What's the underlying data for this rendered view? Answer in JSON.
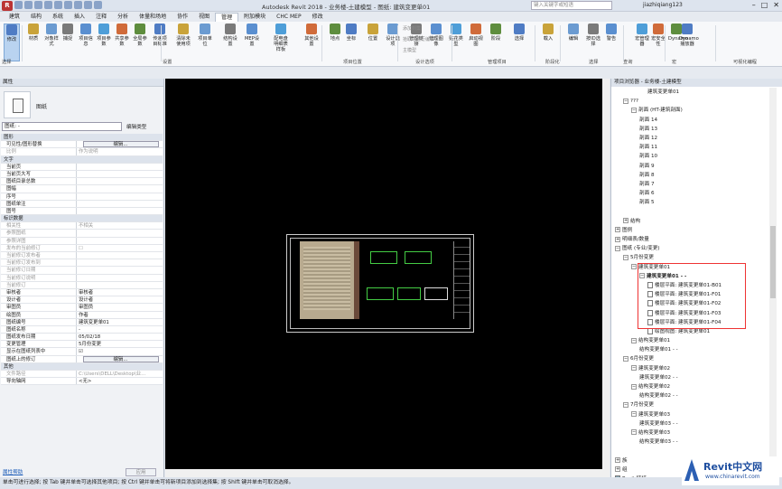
{
  "app": {
    "title": "Autodesk Revit 2018 - 业务楼-土建模型 - 图纸: 建筑变更单01",
    "search_placeholder": "键入关键字或短语",
    "user": "jiazhiqiang123",
    "r_logo": "R"
  },
  "tabs": [
    "建筑",
    "结构",
    "系统",
    "插入",
    "注释",
    "分析",
    "体量和场地",
    "协作",
    "视图",
    "管理",
    "附加模块",
    "CHC MEP",
    "修改"
  ],
  "active_tab": "管理",
  "ribbon": {
    "buttons": [
      "修改",
      "材质",
      "对象样式",
      "捕捉",
      "项目信息",
      "项目参数",
      "共享参数",
      "全局参数",
      "传递项目标准",
      "清除未使用项",
      "项目单位",
      "结构设置",
      "MEP设置",
      "配电盘明细表样板",
      "其他设置",
      "地点",
      "坐标",
      "位置",
      "设计选项",
      "管理链接",
      "管理图像",
      "贴花类型",
      "启动视图",
      "阶段",
      "选择",
      "载入",
      "编辑",
      "按ID选择",
      "警告",
      "宏管理器",
      "宏安全性",
      "Dynamo",
      "Dynamo播放器"
    ],
    "small": [
      "添加到集",
      "拾取以进行编辑",
      "主模型"
    ],
    "panels": [
      "选择",
      "设置",
      "项目位置",
      "设计选项",
      "管理项目",
      "阶段化",
      "选择",
      "查询",
      "宏",
      "可视化编程"
    ]
  },
  "properties": {
    "header": "属性",
    "type_name": "图纸",
    "filter": "图纸: -",
    "edit_type": "编辑类型",
    "rows": [
      {
        "g": "图形"
      },
      {
        "k": "可见性/图形替换",
        "b": "编辑..."
      },
      {
        "k": "比例",
        "v": "作为说明",
        "dim": true
      },
      {
        "g": "文字"
      },
      {
        "k": "当前页",
        "v": ""
      },
      {
        "k": "当前页大写",
        "v": ""
      },
      {
        "k": "图纸目录总数",
        "v": ""
      },
      {
        "k": "图幅",
        "v": ""
      },
      {
        "k": "序号",
        "v": ""
      },
      {
        "k": "图纸单注",
        "v": ""
      },
      {
        "k": "图号",
        "v": ""
      },
      {
        "g": "标识数据"
      },
      {
        "k": "相关性",
        "v": "不相关",
        "dim": true
      },
      {
        "k": "参照图纸",
        "v": "",
        "dim": true
      },
      {
        "k": "参照详图",
        "v": "",
        "dim": true
      },
      {
        "k": "发布的当前修订",
        "v": "☐",
        "dim": true
      },
      {
        "k": "当前修订发布者",
        "v": "",
        "dim": true
      },
      {
        "k": "当前修订发布到",
        "v": "",
        "dim": true
      },
      {
        "k": "当前修订日期",
        "v": "",
        "dim": true
      },
      {
        "k": "当前修订说明",
        "v": "",
        "dim": true
      },
      {
        "k": "当前修订",
        "v": "",
        "dim": true
      },
      {
        "k": "审核者",
        "v": "审核者"
      },
      {
        "k": "设计者",
        "v": "设计者"
      },
      {
        "k": "审图员",
        "v": "审图员"
      },
      {
        "k": "绘图员",
        "v": "作者"
      },
      {
        "k": "图纸编号",
        "v": "建筑变更单01"
      },
      {
        "k": "图纸名称",
        "v": "-"
      },
      {
        "k": "图纸发布日期",
        "v": "05/02/18"
      },
      {
        "k": "变更管理",
        "v": "5月份变更"
      },
      {
        "k": "显示在图纸列表中",
        "v": "☑"
      },
      {
        "k": "图纸上的修订",
        "b": "编辑..."
      },
      {
        "g": "其他"
      },
      {
        "k": "文件路径",
        "v": "C:\\Users\\DELL\\Desktop\\业...",
        "dim": true
      },
      {
        "k": "导向轴网",
        "v": "<无>"
      }
    ],
    "help": "属性帮助",
    "apply": "应用"
  },
  "browser": {
    "header": "项目浏览器 - 业务楼-土建模型",
    "items": [
      {
        "t": "建筑变更单01",
        "l": 4,
        "n": "none"
      },
      {
        "t": "???",
        "l": 1,
        "n": "minus"
      },
      {
        "t": "剖面 (HT-建筑剖面)",
        "l": 2,
        "n": "minus"
      },
      {
        "t": "剖面 14",
        "l": 3,
        "n": "none"
      },
      {
        "t": "剖面 13",
        "l": 3,
        "n": "none"
      },
      {
        "t": "剖面 12",
        "l": 3,
        "n": "none"
      },
      {
        "t": "剖面 11",
        "l": 3,
        "n": "none"
      },
      {
        "t": "剖面 10",
        "l": 3,
        "n": "none"
      },
      {
        "t": "剖面 9",
        "l": 3,
        "n": "none"
      },
      {
        "t": "剖面 8",
        "l": 3,
        "n": "none"
      },
      {
        "t": "剖面 7",
        "l": 3,
        "n": "none"
      },
      {
        "t": "剖面 6",
        "l": 3,
        "n": "none"
      },
      {
        "t": "剖面 5",
        "l": 3,
        "n": "none"
      },
      {
        "t": "",
        "l": 0,
        "n": "none"
      },
      {
        "t": "结构",
        "l": 1,
        "n": "plus"
      },
      {
        "t": "图例",
        "l": 0,
        "n": "plus"
      },
      {
        "t": "明细表/数量",
        "l": 0,
        "n": "plus"
      },
      {
        "t": "图纸 (专业/变更)",
        "l": 0,
        "n": "minus"
      },
      {
        "t": "5月份变更",
        "l": 1,
        "n": "minus"
      },
      {
        "t": "建筑变更单01",
        "l": 2,
        "n": "minus"
      },
      {
        "t": "建筑变更单01 - -",
        "l": 3,
        "n": "minus",
        "b": true
      },
      {
        "t": "楼层平面: 建筑变更单01-B01",
        "l": 4,
        "n": "icon"
      },
      {
        "t": "楼层平面: 建筑变更单01-F01",
        "l": 4,
        "n": "icon"
      },
      {
        "t": "楼层平面: 建筑变更单01-F02",
        "l": 4,
        "n": "icon"
      },
      {
        "t": "楼层平面: 建筑变更单01-F03",
        "l": 4,
        "n": "icon"
      },
      {
        "t": "楼层平面: 建筑变更单01-F04",
        "l": 4,
        "n": "icon"
      },
      {
        "t": "绘图视图: 建筑变更单01",
        "l": 4,
        "n": "icon"
      },
      {
        "t": "结构变更单01",
        "l": 2,
        "n": "minus"
      },
      {
        "t": "结构变更单01 - -",
        "l": 3,
        "n": "none"
      },
      {
        "t": "6月份变更",
        "l": 1,
        "n": "minus"
      },
      {
        "t": "建筑变更单02",
        "l": 2,
        "n": "minus"
      },
      {
        "t": "建筑变更单02 - -",
        "l": 3,
        "n": "none"
      },
      {
        "t": "结构变更单02",
        "l": 2,
        "n": "minus"
      },
      {
        "t": "结构变更单02 - -",
        "l": 3,
        "n": "none"
      },
      {
        "t": "7月份变更",
        "l": 1,
        "n": "minus"
      },
      {
        "t": "建筑变更单03",
        "l": 2,
        "n": "minus"
      },
      {
        "t": "建筑变更单03 - -",
        "l": 3,
        "n": "none"
      },
      {
        "t": "结构变更单03",
        "l": 2,
        "n": "minus"
      },
      {
        "t": "结构变更单03 - -",
        "l": 3,
        "n": "none"
      },
      {
        "t": "",
        "l": 0,
        "n": "none"
      },
      {
        "t": "族",
        "l": 0,
        "n": "plus"
      },
      {
        "t": "组",
        "l": 0,
        "n": "plus"
      },
      {
        "t": "Revit 链接",
        "l": 0,
        "n": "link"
      }
    ]
  },
  "status": "单击可进行选择; 按 Tab 键并单击可选择其他项目; 按 Ctrl 键并单击可将新项目添加到选择集; 按 Shift 键并单击可取消选择。",
  "watermark": {
    "brand": "Revit中文网",
    "url": "www.chinarevit.com"
  },
  "colors": {
    "accent": "#b9d3f0",
    "highlight": "#e33333",
    "canvas": "#000000"
  }
}
